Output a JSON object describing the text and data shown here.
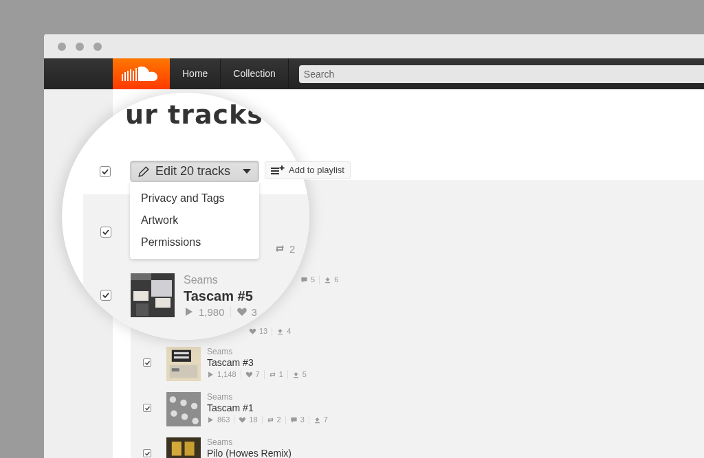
{
  "navbar": {
    "links": [
      {
        "label": "Home"
      },
      {
        "label": "Collection"
      }
    ],
    "search": {
      "placeholder": "Search"
    }
  },
  "magnifier": {
    "heading": "ur tracks",
    "select_all": {
      "checked": true
    },
    "edit_button": {
      "label": "Edit 20 tracks"
    },
    "edit_menu": {
      "expanded": true,
      "items": [
        "Privacy and Tags",
        "Artwork",
        "Permissions"
      ]
    },
    "tracks": [
      {
        "checked": true,
        "stats": [
          {
            "kind": "reposts",
            "text": "2"
          }
        ]
      },
      {
        "checked": true,
        "artist": "Seams",
        "title": "Tascam #5",
        "stats": [
          {
            "kind": "plays",
            "text": "1,980"
          },
          {
            "kind": "likes",
            "text": "3"
          }
        ]
      }
    ]
  },
  "add_to_playlist": {
    "label": "Add to playlist"
  },
  "background_stats": [
    [
      {
        "kind": "comments",
        "text": "5"
      },
      {
        "kind": "downloads",
        "text": "6"
      }
    ],
    [
      {
        "kind": "likes",
        "text": "13"
      },
      {
        "kind": "downloads",
        "text": "4"
      }
    ]
  ],
  "tracks": [
    {
      "checked": true,
      "artist": "Seams",
      "title": "Tascam #3",
      "stats": [
        {
          "kind": "plays",
          "text": "1,148"
        },
        {
          "kind": "likes",
          "text": "7"
        },
        {
          "kind": "reposts",
          "text": "1"
        },
        {
          "kind": "downloads",
          "text": "5"
        }
      ]
    },
    {
      "checked": true,
      "artist": "Seams",
      "title": "Tascam #1",
      "stats": [
        {
          "kind": "plays",
          "text": "863"
        },
        {
          "kind": "likes",
          "text": "18"
        },
        {
          "kind": "reposts",
          "text": "2"
        },
        {
          "kind": "comments",
          "text": "3"
        },
        {
          "kind": "downloads",
          "text": "7"
        }
      ]
    },
    {
      "checked": true,
      "artist": "Seams",
      "title": "Pilo (Howes Remix)"
    }
  ]
}
